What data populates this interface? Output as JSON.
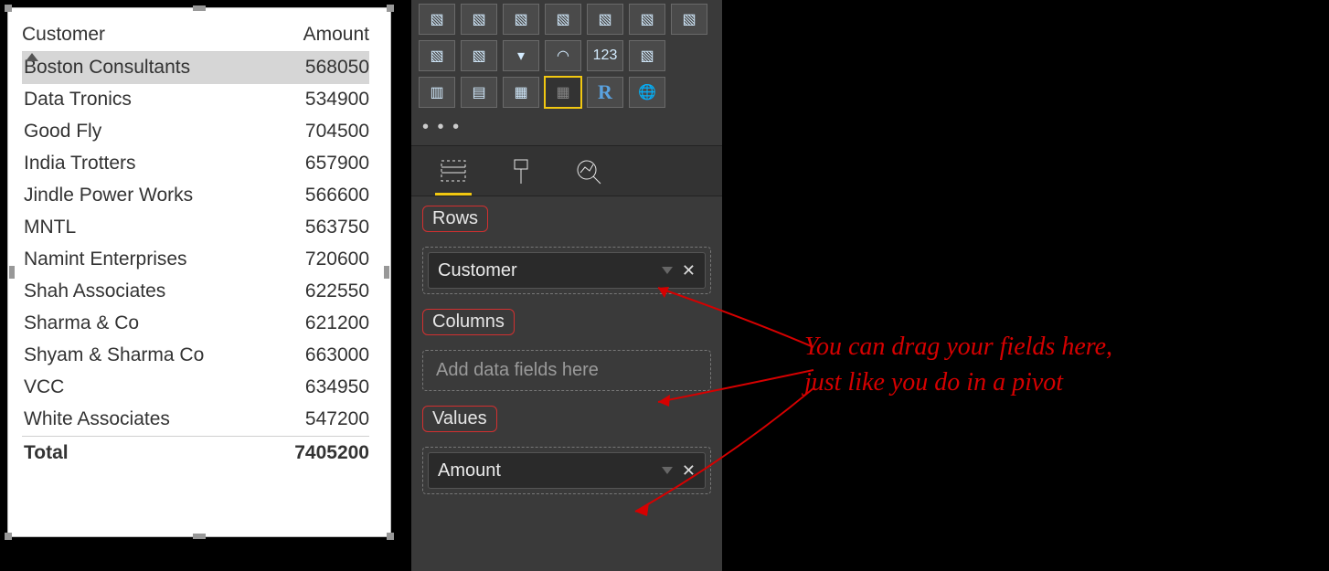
{
  "matrix": {
    "headers": {
      "customer": "Customer",
      "amount": "Amount"
    },
    "rows": [
      {
        "customer": "Boston Consultants",
        "amount": "568050",
        "selected": true
      },
      {
        "customer": "Data Tronics",
        "amount": "534900"
      },
      {
        "customer": "Good Fly",
        "amount": "704500"
      },
      {
        "customer": "India Trotters",
        "amount": "657900"
      },
      {
        "customer": "Jindle Power Works",
        "amount": "566600"
      },
      {
        "customer": "MNTL",
        "amount": "563750"
      },
      {
        "customer": "Namint Enterprises",
        "amount": "720600"
      },
      {
        "customer": "Shah Associates",
        "amount": "622550"
      },
      {
        "customer": "Sharma & Co",
        "amount": "621200"
      },
      {
        "customer": "Shyam & Sharma Co",
        "amount": "663000"
      },
      {
        "customer": "VCC",
        "amount": "634950"
      },
      {
        "customer": "White Associates",
        "amount": "547200"
      }
    ],
    "total": {
      "label": "Total",
      "amount": "7405200"
    }
  },
  "pane": {
    "ellipsis": "• • •",
    "sections": {
      "rows": {
        "label": "Rows",
        "field": "Customer"
      },
      "columns": {
        "label": "Columns",
        "placeholder": "Add data fields here"
      },
      "values": {
        "label": "Values",
        "field": "Amount"
      }
    }
  },
  "viz_icons": {
    "row1": [
      "stacked-bar-icon",
      "stacked-col-icon",
      "line-icon",
      "area-icon",
      "ribbon-icon",
      "waterfall-icon",
      "scatter-icon"
    ],
    "row2": [
      "funnel-icon",
      "tree-icon",
      "filter-icon",
      "gauge-icon",
      "card-icon",
      "multirow-icon"
    ],
    "row3": [
      "kpi-icon",
      "slicer-icon",
      "table-icon",
      "matrix-icon",
      "r-icon",
      "globe-icon"
    ]
  },
  "annotation": {
    "line1": "You can drag your fields here,",
    "line2": "just like you do in a pivot"
  },
  "chart_data": {
    "type": "table",
    "title": "",
    "columns": [
      "Customer",
      "Amount"
    ],
    "rows": [
      [
        "Boston Consultants",
        568050
      ],
      [
        "Data Tronics",
        534900
      ],
      [
        "Good Fly",
        704500
      ],
      [
        "India Trotters",
        657900
      ],
      [
        "Jindle Power Works",
        566600
      ],
      [
        "MNTL",
        563750
      ],
      [
        "Namint Enterprises",
        720600
      ],
      [
        "Shah Associates",
        622550
      ],
      [
        "Sharma & Co",
        621200
      ],
      [
        "Shyam & Sharma Co",
        663000
      ],
      [
        "VCC",
        634950
      ],
      [
        "White Associates",
        547200
      ]
    ],
    "total": [
      "Total",
      7405200
    ]
  }
}
